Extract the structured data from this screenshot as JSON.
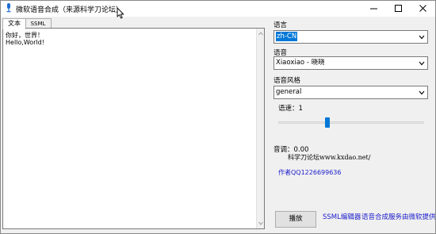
{
  "window": {
    "title": "微软语音合成（来源科学刀论坛）"
  },
  "tabs": [
    {
      "label": "文本"
    },
    {
      "label": "SSML"
    }
  ],
  "editor": {
    "lines": [
      "你好，世界！",
      "Hello,World!"
    ]
  },
  "language": {
    "label": "语言",
    "value": "zh-CN"
  },
  "voice": {
    "label": "语音",
    "value": "Xiaoxiao - 晓晓"
  },
  "style": {
    "label": "语音风格",
    "value": "general"
  },
  "speed": {
    "label": "语速：1",
    "value": 1,
    "range": [
      0,
      3
    ]
  },
  "pitch": {
    "label": "音调：0.00"
  },
  "forum": {
    "text": "科学刀论坛www.kxdao.net/"
  },
  "author": {
    "text": "作者QQ1226699636"
  },
  "play": {
    "label": "播放"
  },
  "links": {
    "ssml_editor": "SSML编辑器",
    "service": "语音合成服务由微软提供"
  },
  "colors": {
    "accent": "#0078d7",
    "link": "#1a1acc"
  },
  "icons": {
    "app": "microphone-icon",
    "cursor": "mouse-pointer-icon",
    "minimize": "minimize-icon",
    "maximize": "maximize-icon",
    "close": "close-icon",
    "chevron": "chevron-down-icon"
  }
}
